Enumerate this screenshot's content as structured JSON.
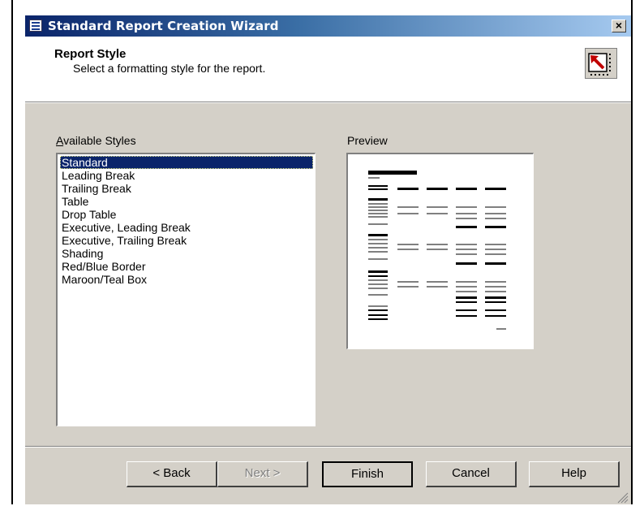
{
  "window": {
    "title": "Standard Report Creation Wizard",
    "close_label": "×"
  },
  "header": {
    "title": "Report Style",
    "subtitle": "Select a formatting style for the report."
  },
  "styles": {
    "label": "Available Styles",
    "items": [
      "Standard",
      "Leading Break",
      "Trailing Break",
      "Table",
      "Drop Table",
      "Executive, Leading Break",
      "Executive, Trailing Break",
      "Shading",
      "Red/Blue Border",
      "Maroon/Teal Box"
    ],
    "selected": "Standard"
  },
  "preview": {
    "label": "Preview"
  },
  "buttons": {
    "back": "< Back",
    "next": "Next >",
    "finish": "Finish",
    "cancel": "Cancel",
    "help": "Help"
  },
  "colors": {
    "titlebar_start": "#0a246a",
    "titlebar_end": "#a6caf0",
    "dialog_face": "#d4d0c8",
    "selection": "#0a246a"
  },
  "icons": [
    "window-app-icon",
    "close-icon",
    "wizard-arrow-icon",
    "resize-grip-icon"
  ]
}
